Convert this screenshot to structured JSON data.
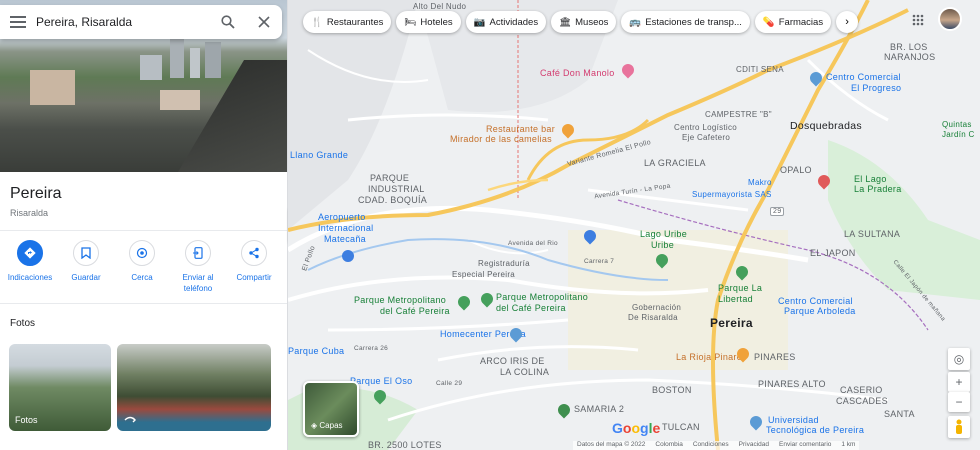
{
  "search": {
    "value": "Pereira, Risaralda"
  },
  "place": {
    "title": "Pereira",
    "subtitle": "Risaralda"
  },
  "actions": [
    {
      "label": "Indicaciones",
      "icon": "directions-icon"
    },
    {
      "label": "Guardar",
      "icon": "bookmark-icon"
    },
    {
      "label": "Cerca",
      "icon": "nearby-icon"
    },
    {
      "label": "Enviar al teléfono",
      "icon": "send-to-phone-icon"
    },
    {
      "label": "Compartir",
      "icon": "share-icon"
    }
  ],
  "photos": {
    "heading": "Fotos",
    "items": [
      {
        "caption": "Fotos"
      },
      {
        "caption": ""
      }
    ]
  },
  "chips": [
    {
      "label": "Restaurantes",
      "icon": "restaurant-icon"
    },
    {
      "label": "Hoteles",
      "icon": "hotel-icon"
    },
    {
      "label": "Actividades",
      "icon": "camera-icon"
    },
    {
      "label": "Museos",
      "icon": "museum-icon"
    },
    {
      "label": "Estaciones de transp...",
      "icon": "transit-icon"
    },
    {
      "label": "Farmacias",
      "icon": "pharmacy-icon"
    }
  ],
  "map_labels": {
    "alto_nudo": "Alto Del Nudo",
    "br_los": "BR. LOS",
    "naranjos": "NARANJOS",
    "cafe": "Café Don Manolo",
    "cditi": "CDITI SENA",
    "cc_progreso1": "Centro Comercial",
    "cc_progreso2": "El Progreso",
    "campestre": "CAMPESTRE \"B\"",
    "dosquebradas": "Dosquebradas",
    "quintas1": "Quintas",
    "quintas2": "Jardín C",
    "rest1": "Restaurante bar",
    "rest2": "Mirador de las camelias",
    "centro_log1": "Centro Logístico",
    "centro_log2": "Eje Cafetero",
    "variante": "Variante Romelia El Pollo",
    "llano": "Llano Grande",
    "graciela": "LA GRACIELA",
    "opalo": "OPALO",
    "lago_pradera1": "El Lago",
    "lago_pradera2": "La Pradera",
    "parque_ind1": "PARQUE",
    "parque_ind2": "INDUSTRIAL",
    "parque_ind3": "CDAD. BOQUÍA",
    "turin": "Avenida Turín - La Popa",
    "makro": "Makro",
    "supermayorista": "Supermayorista SAS",
    "road_29": "29",
    "aero1": "Aeropuerto",
    "aero2": "Internacional",
    "aero3": "Matecaña",
    "av_rio": "Avenida del Rio",
    "sultana": "LA SULTANA",
    "lago_uribe1": "Lago Uribe",
    "lago_uribe2": "Uribe",
    "el_japon": "EL JAPON",
    "el_pollo": "El Pollo",
    "carrera7": "Carrera 7",
    "registraduria1": "Registraduría",
    "registraduria2": "Especial Pereira",
    "parque_libertad1": "Parque La",
    "parque_libertad2": "Libertad",
    "parque_met1a": "Parque Metropolitano",
    "parque_met1b": "del Café Pereira",
    "parque_met2a": "Parque Metropolitano",
    "parque_met2b": "del Café Pereira",
    "gobernacion1": "Gobernación",
    "gobernacion2": "De Risaralda",
    "pereira": "Pereira",
    "cc_arboleda1": "Centro Comercial",
    "cc_arboleda2": "Parque Arboleda",
    "homecenter": "Homecenter Pereira",
    "parque_cuba": "Parque Cuba",
    "carrera26": "Carrera 26",
    "arco1": "ARCO IRIS DE",
    "arco2": "LA COLINA",
    "larioja": "La Rioja Pinares",
    "pinares": "PINARES",
    "pinares_alto": "PINARES ALTO",
    "oso": "Parque El Oso",
    "calle29": "Calle 29",
    "boston": "BOSTON",
    "caserio1": "CASERIO",
    "caserio2": "CASCADES",
    "samaria": "SAMARIA 2",
    "tulcan": "TULCAN",
    "utp1": "Universidad",
    "utp2": "Tecnológica de Pereira",
    "santa": "SANTA",
    "lotes": "BR. 2500 LOTES",
    "calle_japon": "Calle El Japón de mañana"
  },
  "layers": {
    "label": "Capas"
  },
  "footer": {
    "data": "Datos del mapa © 2022",
    "country": "Colombia",
    "terms": "Condiciones",
    "privacy": "Privacidad",
    "feedback": "Enviar comentario",
    "scale": "1 km"
  },
  "google": "Google",
  "colors": {
    "accent": "#1a73e8",
    "road_major": "#f6c75c",
    "park": "#a8dab5"
  }
}
